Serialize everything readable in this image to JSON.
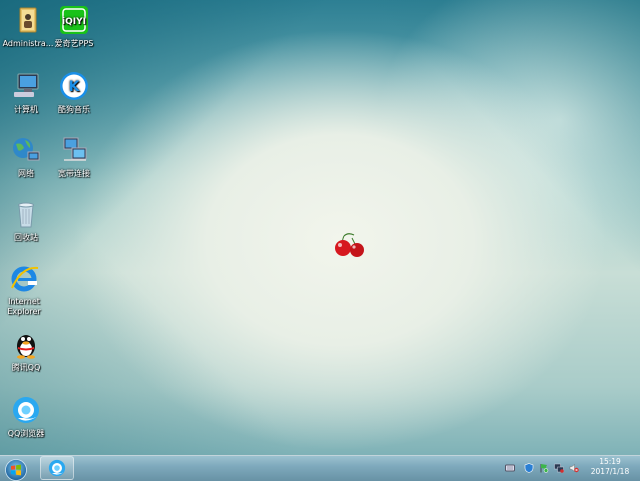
{
  "desktop_icons": [
    {
      "name": "administrator-folder",
      "label": "Administra..."
    },
    {
      "name": "iqiyi-pps",
      "label": "爱奇艺PPS"
    },
    {
      "name": "computer",
      "label": "计算机"
    },
    {
      "name": "kugou-music",
      "label": "酷狗音乐"
    },
    {
      "name": "network",
      "label": "网络"
    },
    {
      "name": "broadband-connection",
      "label": "宽带连接"
    },
    {
      "name": "recycle-bin",
      "label": "回收站"
    },
    {
      "name": "internet-explorer",
      "label": "Internet Explorer"
    },
    {
      "name": "tencent-qq",
      "label": "腾讯QQ"
    },
    {
      "name": "qq-browser",
      "label": "QQ浏览器"
    }
  ],
  "iqiyi_badge": "iQIYI",
  "kugou_letter": "K",
  "clock": {
    "time": "15:19",
    "date": "2017/1/18"
  },
  "taskbar": {
    "pinned": [
      "qq-browser"
    ]
  },
  "colors": {
    "taskbar": "#7fa9bc",
    "iqiyi": "#19c219",
    "kugou": "#1a8fe8",
    "cherry": "#d6181f"
  }
}
